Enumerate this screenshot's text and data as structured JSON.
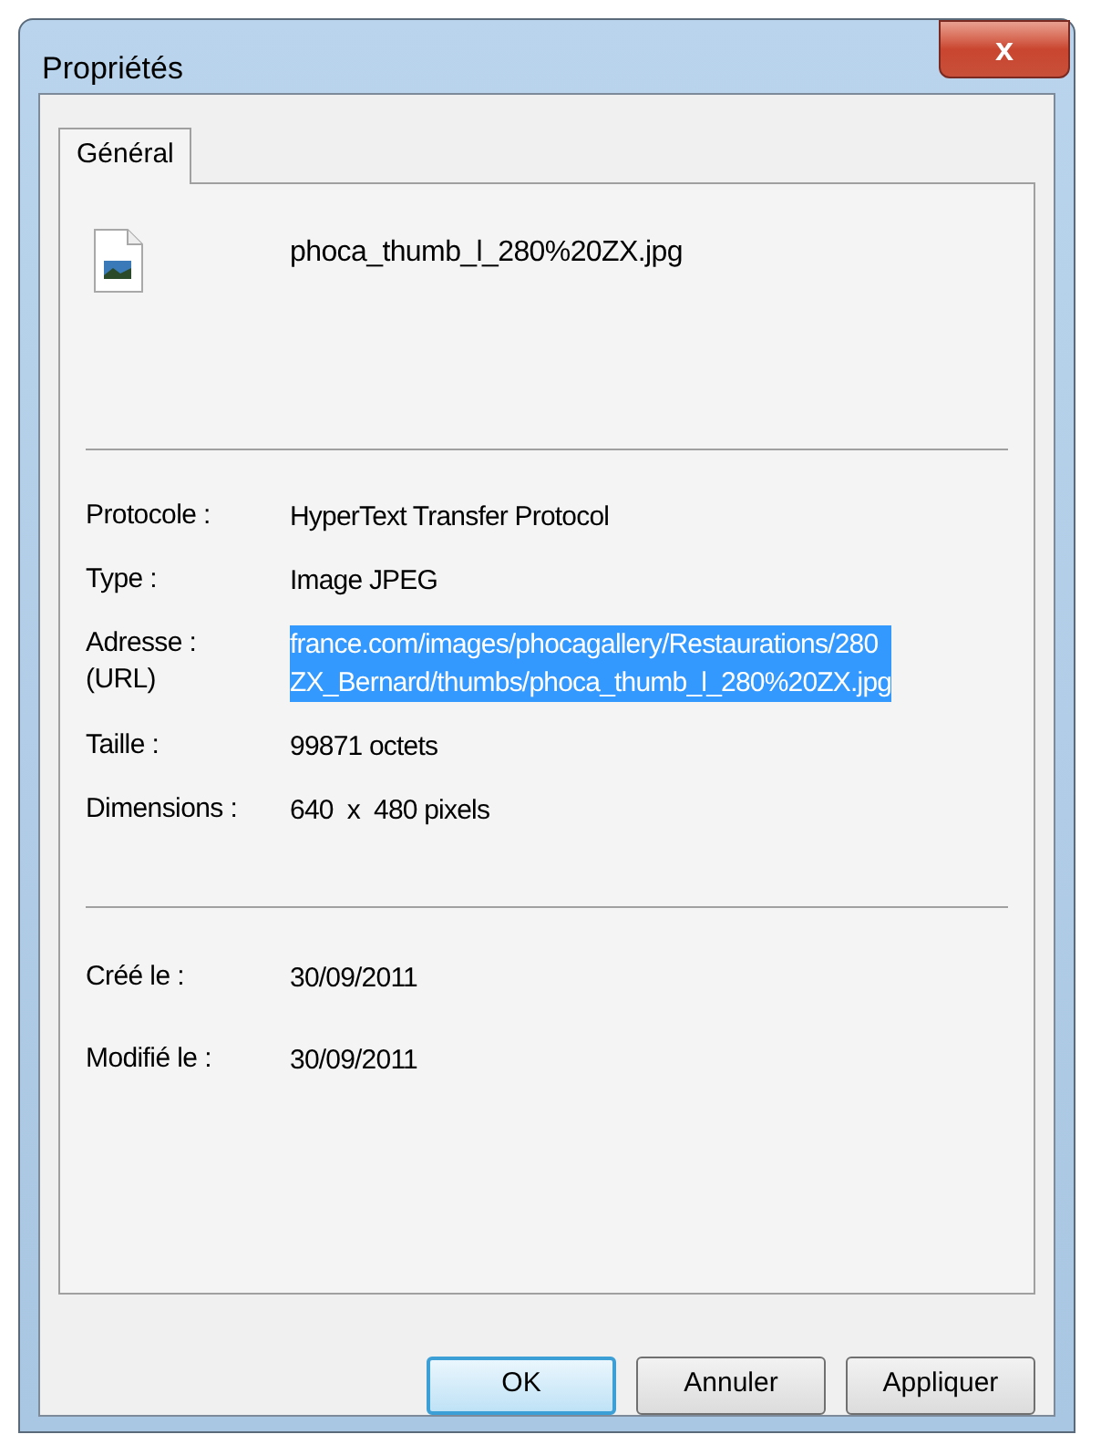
{
  "window": {
    "title": "Propriétés",
    "close": "x"
  },
  "tabs": [
    {
      "label": "Général",
      "selected": true
    }
  ],
  "file": {
    "name": "phoca_thumb_l_280%20ZX.jpg"
  },
  "details": [
    {
      "label": "Protocole :",
      "value": "HyperText Transfer Protocol",
      "selected": false
    },
    {
      "label": "Type :",
      "value": "Image JPEG",
      "selected": false
    },
    {
      "label": "Adresse :\n(URL)",
      "value": "france.com/images/phocagallery/Restaurations/280\nZX_Bernard/thumbs/phoca_thumb_l_280%20ZX.jpg",
      "selected": true
    },
    {
      "label": "Taille :",
      "value": "99871 octets",
      "selected": false
    },
    {
      "label": "Dimensions :",
      "value": "640  x  480 pixels",
      "selected": false
    }
  ],
  "dates": [
    {
      "label": "Créé le :",
      "value": "30/09/2011"
    },
    {
      "label": "Modifié le :",
      "value": "30/09/2011"
    }
  ],
  "buttons": [
    {
      "label": "OK",
      "default": true
    },
    {
      "label": "Annuler",
      "default": false
    },
    {
      "label": "Appliquer",
      "default": false
    }
  ]
}
